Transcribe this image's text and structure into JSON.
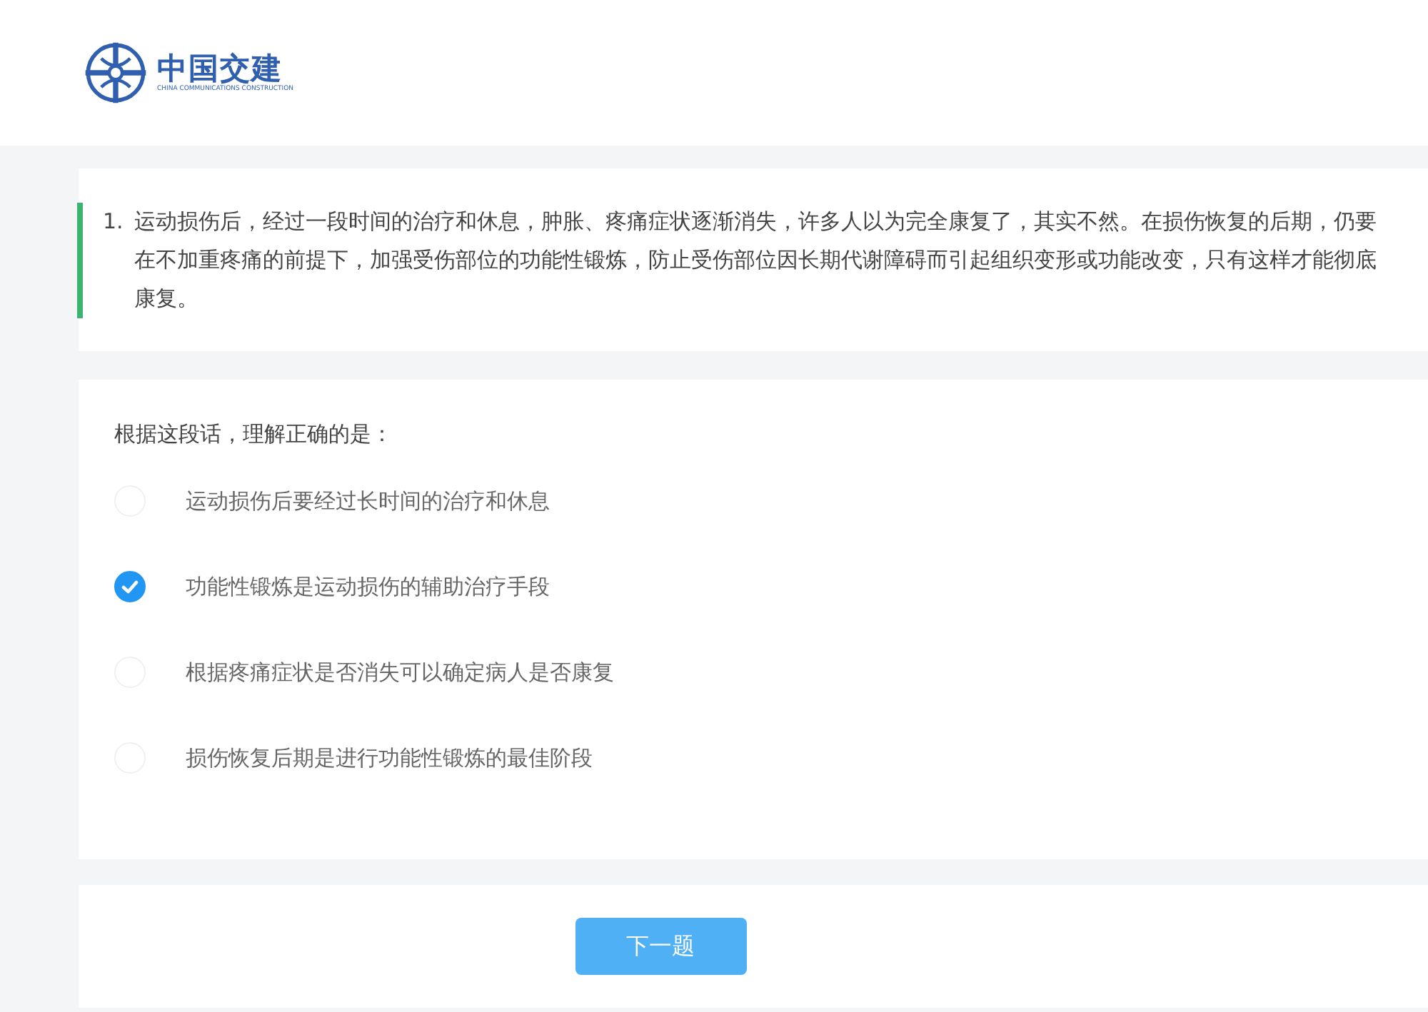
{
  "header": {
    "logo": {
      "name": "中国交建",
      "subtitle": "CHINA COMMUNICATIONS CONSTRUCTION"
    }
  },
  "question": {
    "number": "1.",
    "passage": "运动损伤后，经过一段时间的治疗和休息，肿胀、疼痛症状逐渐消失，许多人以为完全康复了，其实不然。在损伤恢复的后期，仍要在不加重疼痛的前提下，加强受伤部位的功能性锻炼，防止受伤部位因长期代谢障碍而引起组织变形或功能改变，只有这样才能彻底康复。",
    "prompt": "根据这段话，理解正确的是：",
    "options": [
      {
        "label": "运动损伤后要经过长时间的治疗和休息",
        "selected": false
      },
      {
        "label": "功能性锻炼是运动损伤的辅助治疗手段",
        "selected": true
      },
      {
        "label": "根据疼痛症状是否消失可以确定病人是否康复",
        "selected": false
      },
      {
        "label": "损伤恢复后期是进行功能性锻炼的最佳阶段",
        "selected": false
      }
    ]
  },
  "next_button": "下一题"
}
